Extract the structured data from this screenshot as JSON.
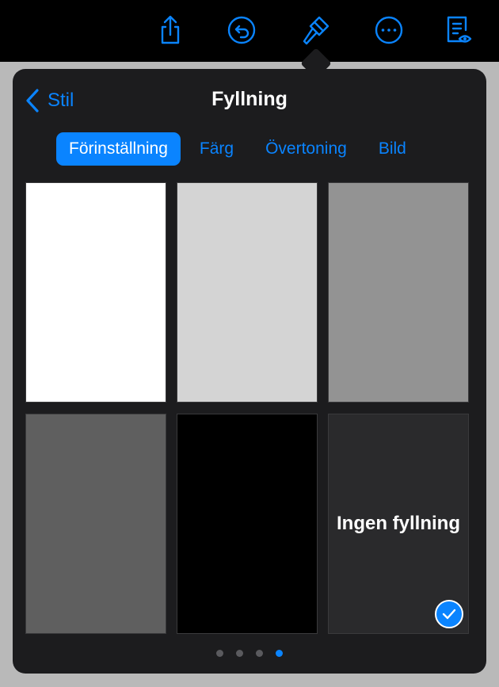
{
  "toolbar": {
    "icons": [
      "share-icon",
      "undo-icon",
      "format-brush-icon",
      "more-icon",
      "reader-view-icon"
    ],
    "accent": "#0a84ff"
  },
  "popover": {
    "back_label": "Stil",
    "title": "Fyllning",
    "tabs": [
      {
        "label": "Förinställning",
        "active": true
      },
      {
        "label": "Färg",
        "active": false
      },
      {
        "label": "Övertoning",
        "active": false
      },
      {
        "label": "Bild",
        "active": false
      }
    ],
    "swatches": [
      {
        "color": "#ffffff"
      },
      {
        "color": "#d4d4d4"
      },
      {
        "color": "#939393"
      },
      {
        "color": "#5f5f5f"
      },
      {
        "color": "#000000"
      },
      {
        "color": "#2a2a2c",
        "label": "Ingen fyllning",
        "selected": true
      }
    ],
    "page_count": 4,
    "current_page": 4
  }
}
